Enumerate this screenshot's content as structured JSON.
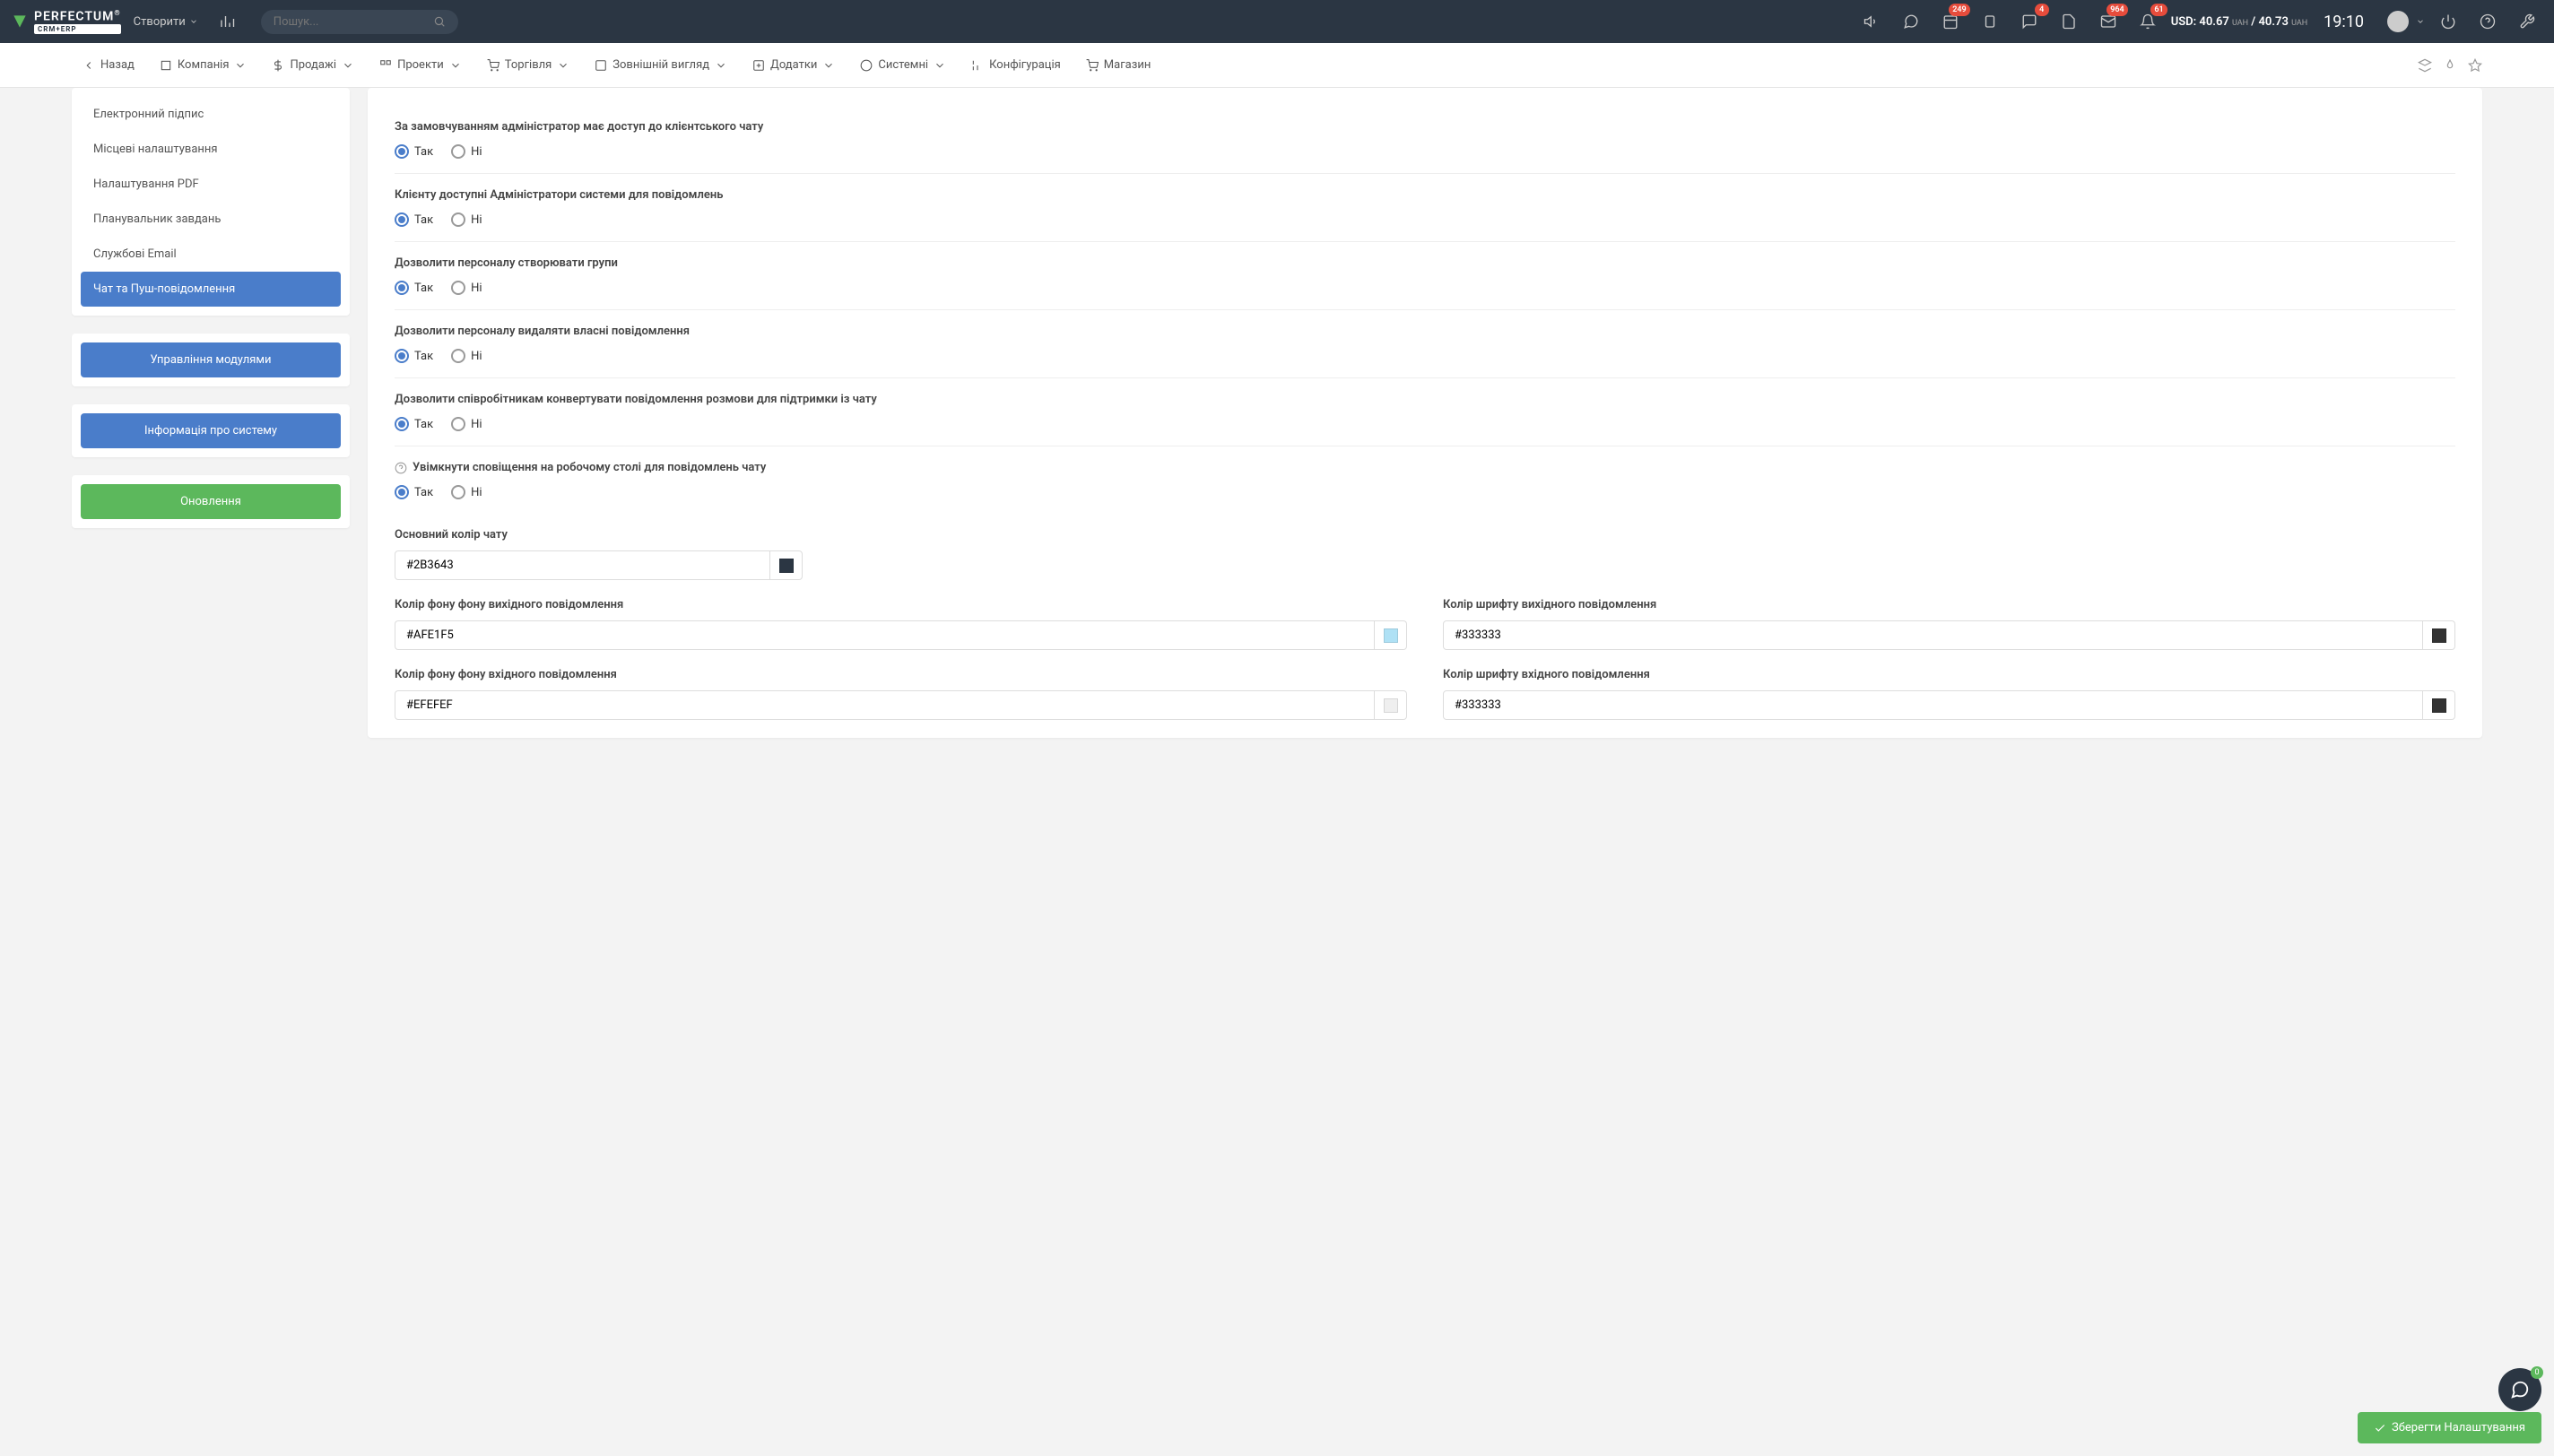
{
  "topbar": {
    "create_label": "Створити",
    "search_placeholder": "Пошук...",
    "badges": {
      "calendar": "249",
      "chat": "4",
      "mail": "964",
      "bell": "61"
    },
    "currency_prefix": "USD:",
    "currency_buy": "40.67",
    "currency_sell": "40.73",
    "currency_unit": "UAH",
    "clock": "19:10"
  },
  "nav": {
    "back": "Назад",
    "items": [
      "Компанія",
      "Продажі",
      "Проекти",
      "Торгівля",
      "Зовнішній вигляд",
      "Додатки",
      "Системні",
      "Конфігурація",
      "Магазин"
    ]
  },
  "sidebar": {
    "links": [
      "Електронний підпис",
      "Місцеві налаштування",
      "Налаштування PDF",
      "Планувальник завдань",
      "Службові Email",
      "Чат та Пуш-повідомлення"
    ],
    "btn_modules": "Управління модулями",
    "btn_sysinfo": "Інформація про систему",
    "btn_update": "Оновлення"
  },
  "settings": {
    "yes": "Так",
    "no": "Ні",
    "rows": [
      "За замовчуванням адміністратор має доступ до клієнтського чату",
      "Клієнту доступні Адміністратори системи для повідомлень",
      "Дозволити персоналу створювати групи",
      "Дозволити персоналу видаляти власні повідомлення",
      "Дозволити співробітникам конвертувати повідомлення розмови для підтримки із чату",
      "Увімкнути сповіщення на робочому столі для повідомлень чату"
    ],
    "color_main_label": "Основний колір чату",
    "color_main": "#2B3643",
    "color_out_bg_label": "Колір фону фону вихідного повідомлення",
    "color_out_bg": "#AFE1F5",
    "color_out_font_label": "Колір шрифту вихідного повідомлення",
    "color_out_font": "#333333",
    "color_in_bg_label": "Колір фону фону вхідного повідомлення",
    "color_in_bg": "#EFEFEF",
    "color_in_font_label": "Колір шрифту вхідного повідомлення",
    "color_in_font": "#333333"
  },
  "footer": {
    "save": "Зберегти Налаштування",
    "chat_count": "0"
  }
}
